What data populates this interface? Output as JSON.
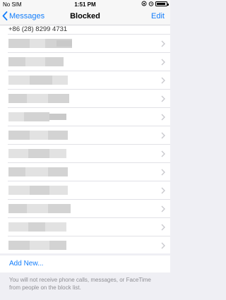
{
  "status_bar": {
    "carrier": "No SIM",
    "time": "1:51 PM"
  },
  "nav": {
    "back_label": "Messages",
    "title": "Blocked",
    "edit_label": "Edit"
  },
  "blocked_list": {
    "first_entry_partial": "+86 (28) 8299 4731",
    "redacted_rows": 12
  },
  "add_new": "Add New...",
  "footer_text": "You will not receive phone calls, messages, or FaceTime from people on the block list.",
  "colors": {
    "accent": "#147efb",
    "background": "#efeff4",
    "secondary_text": "#8e8e93"
  },
  "icons": {
    "back": "chevron-left-icon",
    "disclosure": "chevron-right-icon",
    "alarm": "alarm-icon",
    "battery": "battery-icon"
  }
}
